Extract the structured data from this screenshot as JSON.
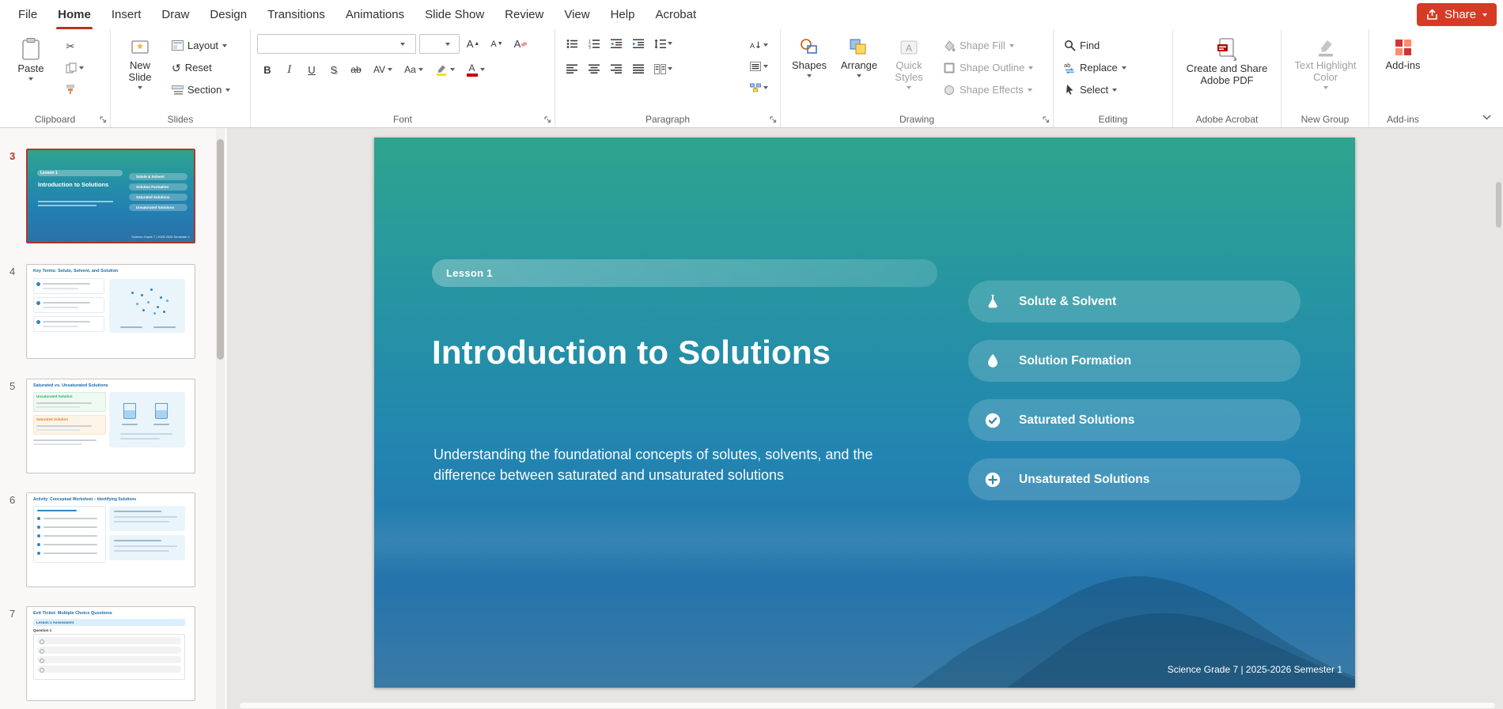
{
  "titlebar": {
    "share_label": "Share"
  },
  "menubar": {
    "items": [
      "File",
      "Home",
      "Insert",
      "Draw",
      "Design",
      "Transitions",
      "Animations",
      "Slide Show",
      "Review",
      "View",
      "Help",
      "Acrobat"
    ],
    "active_item": "Home"
  },
  "ribbon": {
    "clipboard": {
      "group_label": "Clipboard",
      "paste_label": "Paste"
    },
    "slides": {
      "group_label": "Slides",
      "new_slide_label": "New Slide",
      "layout_label": "Layout",
      "reset_label": "Reset",
      "section_label": "Section"
    },
    "font": {
      "group_label": "Font",
      "bold": "B",
      "italic": "I",
      "underline": "U",
      "shadow": "S",
      "strike": "ab",
      "char_spacing": "AV",
      "change_case": "Aa",
      "letter_a": "A",
      "font_name_value": "",
      "font_size_value": ""
    },
    "paragraph": {
      "group_label": "Paragraph"
    },
    "drawing": {
      "group_label": "Drawing",
      "shapes_label": "Shapes",
      "arrange_label": "Arrange",
      "quick_styles_label": "Quick Styles",
      "shape_fill_label": "Shape Fill",
      "shape_outline_label": "Shape Outline",
      "shape_effects_label": "Shape Effects"
    },
    "editing": {
      "group_label": "Editing",
      "find_label": "Find",
      "replace_label": "Replace",
      "select_label": "Select"
    },
    "acrobat": {
      "group_label": "Adobe Acrobat",
      "button_label": "Create and Share Adobe PDF"
    },
    "new_group": {
      "group_label": "New Group",
      "button_label": "Text Highlight Color"
    },
    "addins": {
      "group_label": "Add-ins",
      "button_label": "Add-ins"
    }
  },
  "thumbnails": [
    {
      "number": "3",
      "selected": true,
      "badge": "Lesson 1",
      "title": "Introduction to Solutions",
      "topics": [
        "Solute & Solvent",
        "Solution Formation",
        "Saturated Solutions",
        "Unsaturated Solutions"
      ],
      "footer": "Science Grade 7 | 2025-2026 Semester 1"
    },
    {
      "number": "4",
      "selected": false,
      "title": "Key Terms: Solute, Solvent, and Solution"
    },
    {
      "number": "5",
      "selected": false,
      "title": "Saturated vs. Unsaturated Solutions",
      "box_headers": [
        "Unsaturated Solution",
        "Saturated Solution"
      ]
    },
    {
      "number": "6",
      "selected": false,
      "title": "Activity: Conceptual Worksheet – Identifying Solutions"
    },
    {
      "number": "7",
      "selected": false,
      "title": "Exit Ticket: Multiple Choice Questions",
      "band": "Lesson 1 Assessment",
      "question": "Question 1"
    }
  ],
  "slide": {
    "badge": "Lesson 1",
    "title": "Introduction to Solutions",
    "subtitle": "Understanding the foundational concepts of solutes, solvents, and the difference between saturated and unsaturated solutions",
    "topics": [
      {
        "label": "Solute & Solvent",
        "icon": "flask-icon"
      },
      {
        "label": "Solution Formation",
        "icon": "droplet-icon"
      },
      {
        "label": "Saturated Solutions",
        "icon": "check-circle-icon"
      },
      {
        "label": "Unsaturated Solutions",
        "icon": "plus-circle-icon"
      }
    ],
    "footer": "Science Grade 7 | 2025-2026 Semester 1"
  },
  "colors": {
    "accent_red": "#d53b25",
    "active_tab_underline": "#b7351f",
    "selected_thumbnail_border": "#b3362b",
    "slide_gradient_top": "#2ea48e",
    "slide_gradient_bottom": "#3b7ba6"
  }
}
